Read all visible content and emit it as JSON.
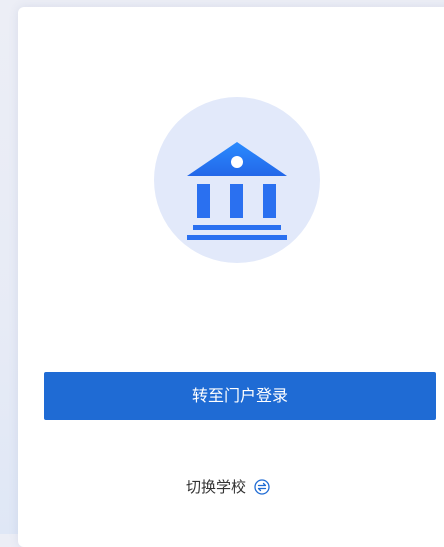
{
  "portal_button": {
    "label": "转至门户登录"
  },
  "switch_school": {
    "label": "切换学校",
    "icon": "swap-icon"
  },
  "emblem": {
    "icon": "institution-building-icon"
  },
  "colors": {
    "accent": "#1f6bd4",
    "emblem_bg": "#e2e9fa"
  }
}
